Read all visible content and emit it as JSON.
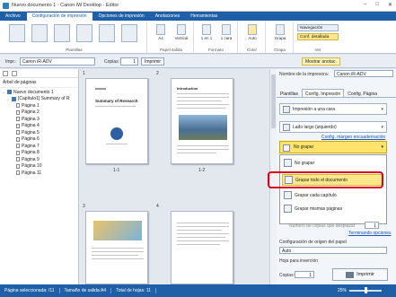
{
  "window": {
    "title": "Nuevo documento 1 - Canon iW Desktop - Editor",
    "controls": [
      "–",
      "□",
      "✕"
    ]
  },
  "tabs": [
    "Archivo",
    "Configuración de impresión",
    "Opciones de impresión",
    "Anotaciones",
    "Herramientas"
  ],
  "ribbon": {
    "groups": [
      "Plantillas",
      "Papel salida",
      "Formato",
      "Color",
      "Grapa",
      "Ver"
    ],
    "buttons": {
      "size": "A4",
      "orientation": "Vertical",
      "layout": "1 en 1",
      "sides": "1 cara",
      "color": "Auto",
      "staple": "Grapa",
      "nav": "Navegación",
      "detail": "Conf. detallada"
    }
  },
  "toolbar": {
    "printer_label": "Impr.:",
    "printer_value": "Canon iR-ADV",
    "copies_label": "Copias:",
    "copies_value": "1",
    "print_button": "Imprimir",
    "show_notes": "Mostrar anotac."
  },
  "leftpane": {
    "header": "Árbol de páginas",
    "tree": [
      {
        "label": "Nuevo documento 1",
        "kind": "book",
        "indent": 0,
        "expander": "–"
      },
      {
        "label": "[Capítulo1] Summary of R",
        "kind": "chapter",
        "indent": 1,
        "expander": "–"
      },
      {
        "label": "Página 1",
        "kind": "page",
        "indent": 2
      },
      {
        "label": "Página 2",
        "kind": "page",
        "indent": 2
      },
      {
        "label": "Página 3",
        "kind": "page",
        "indent": 2
      },
      {
        "label": "Página 4",
        "kind": "page",
        "indent": 2
      },
      {
        "label": "Página 5",
        "kind": "page",
        "indent": 2
      },
      {
        "label": "Página 6",
        "kind": "page",
        "indent": 2
      },
      {
        "label": "Página 7",
        "kind": "page",
        "indent": 2
      },
      {
        "label": "Página 8",
        "kind": "page",
        "indent": 2
      },
      {
        "label": "Página 9",
        "kind": "page",
        "indent": 2
      },
      {
        "label": "Página 10",
        "kind": "page",
        "indent": 2
      },
      {
        "label": "Página 11",
        "kind": "page",
        "indent": 2
      }
    ]
  },
  "center": {
    "thumbnails": [
      {
        "num": "1",
        "label": "1-1",
        "heading": "Summary of Research"
      },
      {
        "num": "2",
        "label": "1-2",
        "heading": "Introduction"
      },
      {
        "num": "3",
        "label": "",
        "heading": ""
      },
      {
        "num": "4",
        "label": "",
        "heading": ""
      }
    ]
  },
  "rightpane": {
    "printer_label": "Nombre de la impresora:",
    "printer_value": "Canon iR-ADV",
    "tabs": [
      "Plantillas",
      "Config. Impresión",
      "Config. Página"
    ],
    "active_tab": "Config. Impresión",
    "print_mode": "Impresión a una cara",
    "binding": "Lado largo (izquierdo)",
    "binding_margin_link": "Config. margen encuadernación",
    "staple_current": "No grapar",
    "staple_options": [
      "No grapar",
      "Grapar todo el documento",
      "Grapar cada capítulo",
      "Grapar mismas páginas"
    ],
    "highlighted_option": "Grapar todo el documento",
    "copies_hint": "Número de copias que desplazar",
    "copies_hint_value": "1",
    "finish_link": "Terminando opciones",
    "paper_source_label": "Configuración de origen del papel",
    "paper_source_value": "Auto",
    "insert_label": "Hoja para inserción",
    "copies_label": "Copias:",
    "copies_value": "1",
    "print_button": "Imprimir"
  },
  "statusbar": {
    "selected": "Página seleccionada: /11",
    "size": "Tamaño de salida:A4",
    "total": "Total de hojas: 11",
    "zoom": "25%"
  }
}
